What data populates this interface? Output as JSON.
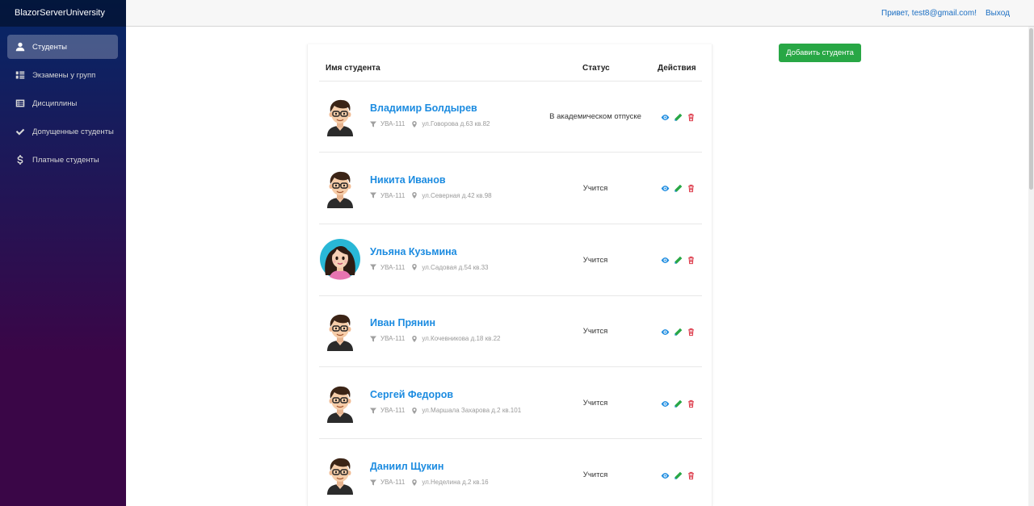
{
  "app": {
    "brand": "BlazorServerUniversity"
  },
  "sidebar": {
    "items": [
      {
        "label": "Студенты",
        "icon": "person-icon",
        "active": true
      },
      {
        "label": "Экзамены у групп",
        "icon": "grid-list-icon",
        "active": false
      },
      {
        "label": "Дисциплины",
        "icon": "list-icon",
        "active": false
      },
      {
        "label": "Допущенные студенты",
        "icon": "check-icon",
        "active": false
      },
      {
        "label": "Платные студенты",
        "icon": "dollar-icon",
        "active": false
      }
    ]
  },
  "topbar": {
    "greeting": "Привет, test8@gmail.com!",
    "logout": "Выход"
  },
  "table": {
    "headers": {
      "name": "Имя студента",
      "status": "Статус",
      "actions": "Действия"
    },
    "rows": [
      {
        "name": "Владимир Болдырев",
        "group": "УВА-111",
        "address": "ул.Говорова д.63 кв.82",
        "status": "В академическом отпуске",
        "avatar": "male"
      },
      {
        "name": "Никита Иванов",
        "group": "УВА-111",
        "address": "ул.Северная д.42 кв.98",
        "status": "Учится",
        "avatar": "male"
      },
      {
        "name": "Ульяна Кузьмина",
        "group": "УВА-111",
        "address": "ул.Садовая д.54 кв.33",
        "status": "Учится",
        "avatar": "female"
      },
      {
        "name": "Иван Прянин",
        "group": "УВА-111",
        "address": "ул.Кочевникова д.18 кв.22",
        "status": "Учится",
        "avatar": "male"
      },
      {
        "name": "Сергей Федоров",
        "group": "УВА-111",
        "address": "ул.Маршала Захарова д.2 кв.101",
        "status": "Учится",
        "avatar": "male"
      },
      {
        "name": "Даниил Щукин",
        "group": "УВА-111",
        "address": "ул.Неделина д.2 кв.16",
        "status": "Учится",
        "avatar": "male"
      }
    ]
  },
  "add_button": {
    "label": "Добавить студента"
  },
  "colors": {
    "link": "#1b8be0",
    "view": "#1b8be0",
    "edit": "#28a745",
    "delete": "#dc3545",
    "add": "#28a745"
  }
}
